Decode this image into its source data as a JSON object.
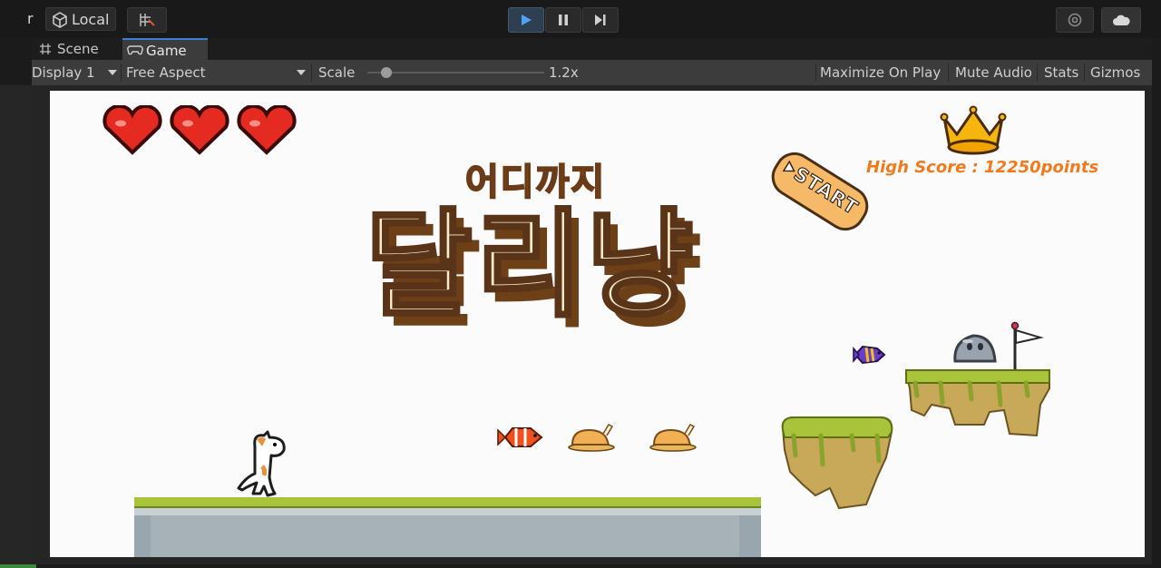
{
  "toolbar": {
    "stub_label": "r",
    "local_label": "Local",
    "play_icon": "play-icon",
    "pause_icon": "pause-icon",
    "step_icon": "step-icon"
  },
  "tabs": [
    {
      "label": "Scene",
      "icon": "grid-icon"
    },
    {
      "label": "Game",
      "icon": "gamepad-icon",
      "active": true
    }
  ],
  "game_options": {
    "display": "Display 1",
    "aspect": "Free Aspect",
    "scale_label": "Scale",
    "scale_value": "1.2x",
    "scale_level": 0.1,
    "maximize": "Maximize On Play",
    "mute": "Mute Audio",
    "stats": "Stats",
    "gizmos": "Gizmos"
  },
  "game": {
    "hearts": 3,
    "title_small": "어디까지",
    "title_big": "달리냥",
    "start_label": "START",
    "high_score": "High Score : 12250points"
  },
  "colors": {
    "accent_play": "#3a7fd4",
    "high_score": "#f07a1c",
    "heart": "#e52a22",
    "grass": "#a9c33a"
  }
}
